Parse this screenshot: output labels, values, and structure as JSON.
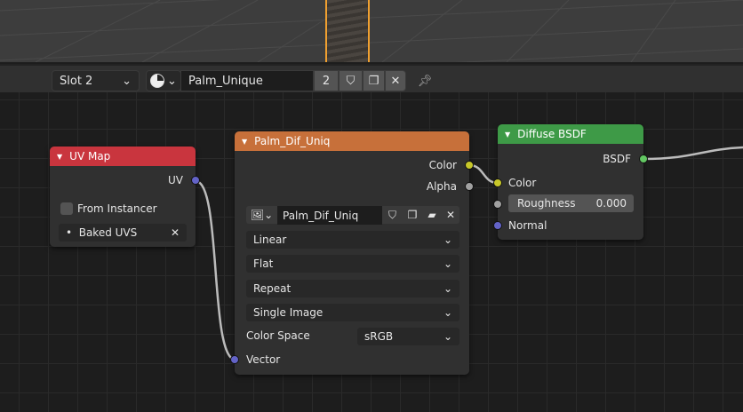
{
  "header": {
    "slot": "Slot 2",
    "material_name": "Palm_Unique",
    "users": "2"
  },
  "uv_node": {
    "title": "UV Map",
    "output_uv": "UV",
    "from_instancer": "From Instancer",
    "uv_map": "Baked UVS",
    "color": "#c9353e"
  },
  "image_node": {
    "title": "Palm_Dif_Uniq",
    "out_color": "Color",
    "out_alpha": "Alpha",
    "image_name": "Palm_Dif_Uniq",
    "interpolation": "Linear",
    "projection": "Flat",
    "extension": "Repeat",
    "source": "Single Image",
    "color_space_label": "Color Space",
    "color_space": "sRGB",
    "in_vector": "Vector",
    "color": "#c7703a"
  },
  "bsdf_node": {
    "title": "Diffuse BSDF",
    "out_bsdf": "BSDF",
    "in_color": "Color",
    "roughness_label": "Roughness",
    "roughness": "0.000",
    "in_normal": "Normal",
    "color": "#3e9a47"
  }
}
